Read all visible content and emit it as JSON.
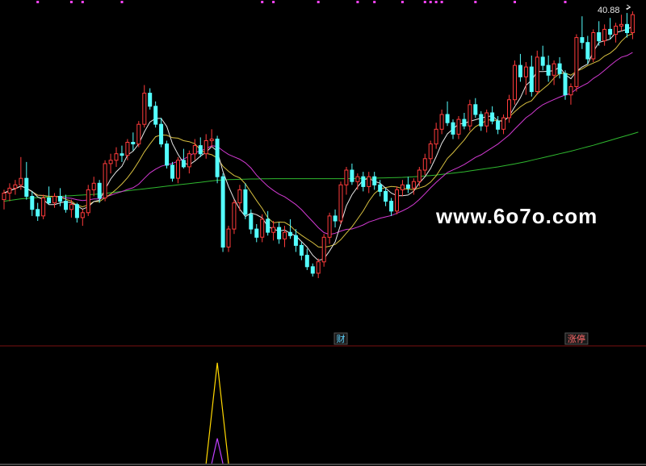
{
  "chart_data": {
    "type": "candlestick",
    "price_max_label": "40.88",
    "watermark": "www.6o7o.com",
    "markers": [
      {
        "text": "财",
        "index": 60,
        "color": "#5fd4ff"
      },
      {
        "text": "涨停",
        "index": 102,
        "color": "#ff6a6a"
      }
    ],
    "top_dot_indices": [
      6,
      12,
      14,
      21,
      46,
      48,
      56,
      63,
      66,
      71,
      75,
      76,
      77,
      78,
      84,
      91,
      100
    ],
    "ohlc": [
      [
        29.2,
        29.8,
        28.6,
        29.6
      ],
      [
        29.6,
        30.2,
        29.1,
        29.9
      ],
      [
        29.9,
        30.4,
        29.5,
        30.1
      ],
      [
        30.1,
        31.8,
        29.8,
        30.5
      ],
      [
        30.5,
        31.5,
        29.2,
        29.4
      ],
      [
        29.4,
        29.7,
        28.2,
        28.6
      ],
      [
        28.6,
        29.0,
        27.9,
        28.2
      ],
      [
        28.2,
        29.5,
        28.0,
        29.3
      ],
      [
        29.3,
        30.0,
        28.9,
        29.0
      ],
      [
        29.0,
        29.6,
        28.7,
        29.4
      ],
      [
        29.4,
        29.9,
        28.8,
        29.1
      ],
      [
        29.1,
        29.5,
        28.4,
        28.6
      ],
      [
        28.6,
        29.2,
        28.1,
        28.9
      ],
      [
        28.9,
        29.0,
        27.8,
        28.1
      ],
      [
        28.1,
        28.6,
        27.6,
        28.4
      ],
      [
        28.4,
        30.1,
        28.2,
        29.8
      ],
      [
        29.8,
        30.6,
        29.4,
        30.2
      ],
      [
        30.2,
        30.4,
        29.0,
        29.3
      ],
      [
        29.3,
        31.6,
        29.1,
        31.4
      ],
      [
        31.4,
        32.0,
        30.8,
        31.6
      ],
      [
        31.6,
        32.4,
        31.2,
        32.0
      ],
      [
        32.0,
        32.5,
        31.5,
        31.9
      ],
      [
        31.9,
        32.9,
        31.6,
        32.7
      ],
      [
        32.7,
        33.3,
        32.2,
        32.6
      ],
      [
        32.6,
        34.0,
        32.4,
        33.8
      ],
      [
        33.8,
        36.2,
        33.6,
        35.7
      ],
      [
        35.7,
        36.0,
        34.7,
        34.9
      ],
      [
        34.9,
        35.2,
        33.6,
        33.8
      ],
      [
        33.8,
        34.2,
        32.4,
        32.6
      ],
      [
        32.6,
        32.8,
        31.1,
        31.3
      ],
      [
        31.3,
        31.5,
        30.3,
        30.5
      ],
      [
        30.5,
        31.8,
        30.2,
        31.6
      ],
      [
        31.6,
        32.3,
        31.1,
        31.2
      ],
      [
        31.2,
        32.2,
        30.8,
        32.0
      ],
      [
        32.0,
        32.9,
        31.6,
        32.5
      ],
      [
        32.5,
        33.0,
        31.8,
        32.0
      ],
      [
        32.0,
        33.2,
        31.7,
        32.8
      ],
      [
        32.8,
        33.5,
        32.4,
        32.9
      ],
      [
        32.9,
        33.1,
        30.2,
        30.6
      ],
      [
        30.6,
        30.8,
        26.0,
        26.3
      ],
      [
        26.3,
        27.6,
        26.0,
        27.4
      ],
      [
        27.4,
        29.2,
        27.1,
        29.0
      ],
      [
        29.0,
        30.1,
        28.5,
        29.8
      ],
      [
        29.8,
        30.2,
        28.0,
        28.3
      ],
      [
        28.3,
        28.6,
        27.1,
        27.4
      ],
      [
        27.4,
        27.7,
        26.6,
        26.9
      ],
      [
        26.9,
        28.3,
        26.6,
        28.0
      ],
      [
        28.0,
        28.5,
        27.0,
        27.2
      ],
      [
        27.2,
        27.9,
        26.7,
        27.5
      ],
      [
        27.5,
        27.8,
        26.5,
        26.8
      ],
      [
        26.8,
        27.6,
        26.3,
        27.2
      ],
      [
        27.2,
        28.0,
        26.8,
        27.0
      ],
      [
        27.0,
        27.4,
        26.0,
        26.4
      ],
      [
        26.4,
        26.6,
        25.5,
        25.8
      ],
      [
        25.8,
        26.2,
        24.9,
        25.1
      ],
      [
        25.1,
        25.3,
        24.5,
        24.7
      ],
      [
        24.7,
        25.6,
        24.4,
        25.4
      ],
      [
        25.4,
        27.1,
        25.1,
        26.9
      ],
      [
        26.9,
        28.4,
        26.5,
        28.2
      ],
      [
        28.2,
        28.6,
        27.5,
        27.9
      ],
      [
        27.9,
        30.3,
        27.7,
        30.1
      ],
      [
        30.1,
        31.2,
        29.5,
        31.0
      ],
      [
        31.0,
        31.4,
        30.1,
        30.3
      ],
      [
        30.3,
        30.8,
        29.8,
        30.6
      ],
      [
        30.6,
        30.9,
        29.7,
        30.0
      ],
      [
        30.0,
        30.9,
        29.6,
        30.6
      ],
      [
        30.6,
        30.9,
        29.8,
        30.1
      ],
      [
        30.1,
        30.4,
        29.4,
        29.7
      ],
      [
        29.7,
        29.9,
        28.8,
        29.1
      ],
      [
        29.1,
        29.3,
        28.2,
        28.5
      ],
      [
        28.5,
        30.0,
        28.3,
        29.8
      ],
      [
        29.8,
        30.4,
        29.4,
        30.1
      ],
      [
        30.1,
        30.6,
        29.6,
        29.9
      ],
      [
        29.9,
        30.5,
        29.5,
        30.3
      ],
      [
        30.3,
        31.2,
        30.0,
        31.0
      ],
      [
        31.0,
        32.0,
        30.7,
        31.7
      ],
      [
        31.7,
        32.8,
        31.4,
        32.6
      ],
      [
        32.6,
        33.9,
        32.3,
        33.5
      ],
      [
        33.5,
        34.7,
        33.2,
        34.4
      ],
      [
        34.4,
        35.2,
        33.7,
        33.9
      ],
      [
        33.9,
        34.1,
        32.9,
        33.2
      ],
      [
        33.2,
        34.3,
        32.9,
        34.1
      ],
      [
        34.1,
        34.5,
        33.5,
        33.7
      ],
      [
        33.7,
        35.3,
        33.4,
        35.0
      ],
      [
        35.0,
        35.4,
        34.2,
        34.4
      ],
      [
        34.4,
        34.6,
        33.4,
        33.7
      ],
      [
        33.7,
        34.7,
        33.3,
        34.5
      ],
      [
        34.5,
        34.9,
        33.8,
        34.0
      ],
      [
        34.0,
        34.3,
        33.2,
        33.5
      ],
      [
        33.5,
        34.4,
        33.2,
        34.2
      ],
      [
        34.2,
        35.6,
        33.9,
        35.3
      ],
      [
        35.3,
        37.7,
        35.0,
        37.4
      ],
      [
        37.4,
        38.1,
        36.4,
        36.7
      ],
      [
        36.7,
        37.6,
        35.6,
        37.3
      ],
      [
        37.3,
        38.0,
        35.5,
        35.8
      ],
      [
        35.8,
        38.3,
        35.6,
        37.9
      ],
      [
        37.9,
        38.6,
        37.1,
        37.4
      ],
      [
        37.4,
        38.0,
        36.4,
        36.8
      ],
      [
        36.8,
        37.7,
        36.2,
        37.5
      ],
      [
        37.5,
        37.9,
        36.6,
        36.9
      ],
      [
        36.9,
        37.1,
        35.3,
        35.6
      ],
      [
        35.6,
        36.3,
        35.0,
        36.1
      ],
      [
        36.1,
        39.3,
        35.8,
        39.1
      ],
      [
        39.1,
        40.4,
        38.4,
        38.8
      ],
      [
        38.8,
        39.2,
        37.5,
        37.8
      ],
      [
        37.8,
        39.6,
        37.6,
        39.4
      ],
      [
        39.4,
        40.1,
        38.6,
        38.9
      ],
      [
        38.9,
        39.9,
        38.6,
        39.6
      ],
      [
        39.6,
        40.3,
        39.0,
        39.3
      ],
      [
        39.3,
        40.0,
        38.8,
        39.8
      ],
      [
        39.8,
        40.5,
        39.5,
        39.9
      ],
      [
        39.9,
        40.6,
        39.1,
        39.4
      ],
      [
        39.4,
        40.7,
        39.0,
        40.5
      ]
    ],
    "long_ma": [
      29.1,
      29.15,
      29.2,
      29.25,
      29.28,
      29.3,
      29.32,
      29.34,
      29.36,
      29.38,
      29.4,
      29.42,
      29.44,
      29.46,
      29.48,
      29.5,
      29.52,
      29.55,
      29.58,
      29.62,
      29.66,
      29.7,
      29.74,
      29.78,
      29.82,
      29.86,
      29.9,
      29.94,
      29.98,
      30.02,
      30.06,
      30.1,
      30.14,
      30.18,
      30.22,
      30.26,
      30.3,
      30.34,
      30.38,
      30.4,
      30.42,
      30.43,
      30.44,
      30.45,
      30.46,
      30.46,
      30.47,
      30.47,
      30.48,
      30.48,
      30.48,
      30.48,
      30.48,
      30.48,
      30.48,
      30.48,
      30.48,
      30.48,
      30.48,
      30.48,
      30.48,
      30.48,
      30.49,
      30.49,
      30.5,
      30.5,
      30.51,
      30.52,
      30.53,
      30.54,
      30.55,
      30.56,
      30.58,
      30.6,
      30.62,
      30.64,
      30.67,
      30.7,
      30.74,
      30.78,
      30.82,
      30.86,
      30.9,
      30.95,
      31.0,
      31.05,
      31.1,
      31.15,
      31.2,
      31.26,
      31.32,
      31.38,
      31.45,
      31.52,
      31.6,
      31.68,
      31.76,
      31.84,
      31.92,
      32.0,
      32.08,
      32.16,
      32.25,
      32.34,
      32.43,
      32.52,
      32.62,
      32.72,
      32.82,
      32.92,
      33.02,
      33.12,
      33.22,
      33.32
    ],
    "indicator": {
      "spike_index": 38,
      "outer_value": 1.0,
      "inner_value": 0.25
    }
  }
}
